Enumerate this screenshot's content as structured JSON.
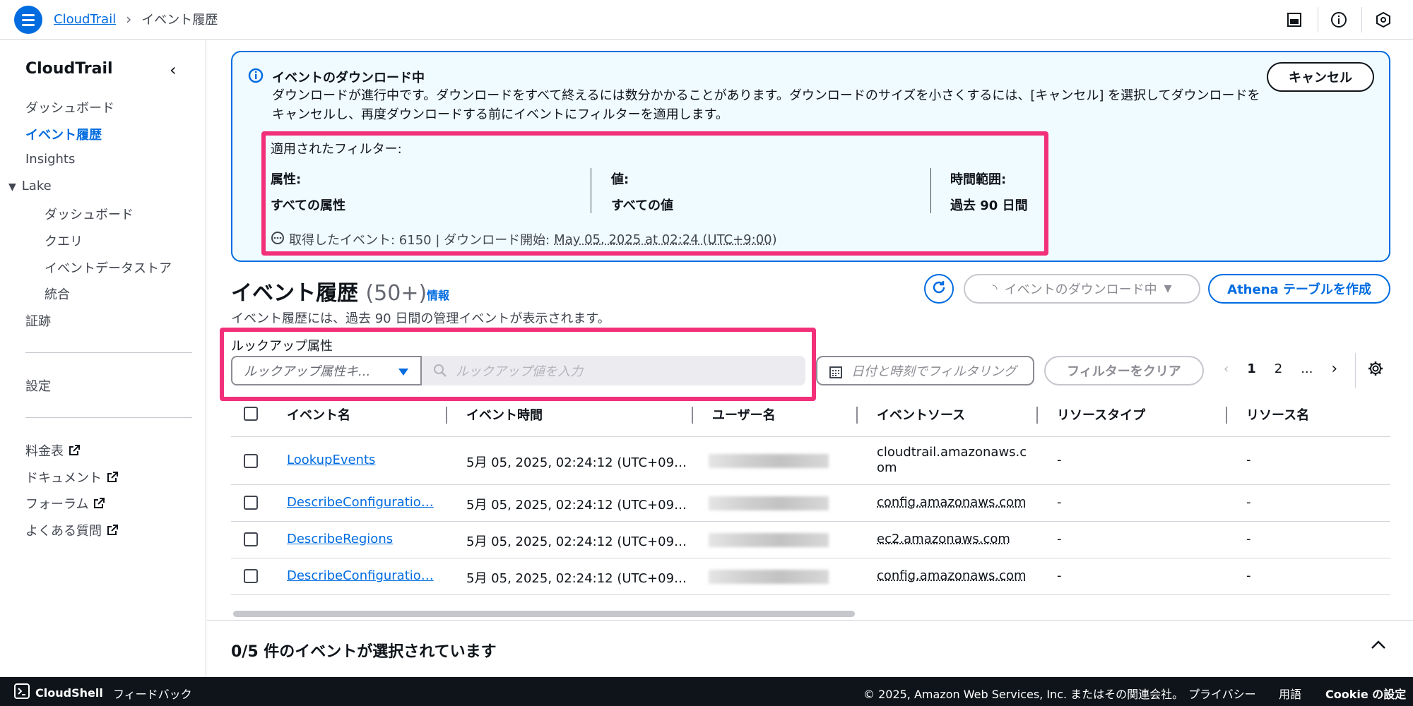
{
  "topbar": {
    "breadcrumb_root": "CloudTrail",
    "breadcrumb_current": "イベント履歴"
  },
  "sidebar": {
    "title": "CloudTrail",
    "items": [
      {
        "label": "ダッシュボード"
      },
      {
        "label": "イベント履歴"
      },
      {
        "label": "Insights"
      },
      {
        "label": "Lake"
      },
      {
        "label": "ダッシュボード"
      },
      {
        "label": "クエリ"
      },
      {
        "label": "イベントデータストア"
      },
      {
        "label": "統合"
      },
      {
        "label": "証跡"
      },
      {
        "label": "設定"
      },
      {
        "label": "料金表"
      },
      {
        "label": "ドキュメント"
      },
      {
        "label": "フォーラム"
      },
      {
        "label": "よくある質問"
      }
    ]
  },
  "banner": {
    "title": "イベントのダウンロード中",
    "description": "ダウンロードが進行中です。ダウンロードをすべて終えるには数分かかることがあります。ダウンロードのサイズを小さくするには、[キャンセル] を選択してダウンロードをキャンセルし、再度ダウンロードする前にイベントにフィルターを適用します。",
    "cancel_label": "キャンセル",
    "applied_filters_label": "適用されたフィルター:",
    "filters": [
      {
        "header": "属性:",
        "value": "すべての属性"
      },
      {
        "header": "値:",
        "value": "すべての値"
      },
      {
        "header": "時間範囲:",
        "value": "過去 90 日間"
      }
    ],
    "fetched_text": "取得したイベント: 6150 | ダウンロード開始:",
    "download_start": "May 05, 2025 at 02:24 (UTC+9:00)"
  },
  "history": {
    "title": "イベント履歴",
    "count": "(50+)",
    "info_label": "情報",
    "description": "イベント履歴には、過去 90 日間の管理イベントが表示されます。",
    "downloading_label": "イベントのダウンロード中",
    "athena_label": "Athena テーブルを作成"
  },
  "lookup": {
    "label": "ルックアップ属性",
    "select_placeholder": "ルックアップ属性キ...",
    "input_placeholder": "ルックアップ値を入力",
    "date_filter_label": "日付と時刻でフィルタリング",
    "clear_label": "フィルターをクリア"
  },
  "pagination": {
    "pages": [
      "1",
      "2",
      "..."
    ]
  },
  "table": {
    "headers": [
      "イベント名",
      "イベント時間",
      "ユーザー名",
      "イベントソース",
      "リソースタイプ",
      "リソース名"
    ],
    "rows": [
      {
        "event": "LookupEvents",
        "time": "5月 05, 2025, 02:24:12 (UTC+09…",
        "source_line1": "cloudtrail.amazonaws.c",
        "source_line2": "om",
        "type": "-",
        "name": "-"
      },
      {
        "event": "DescribeConfiguratio…",
        "time": "5月 05, 2025, 02:24:12 (UTC+09…",
        "source_line1": "config.amazonaws.com",
        "type": "-",
        "name": "-"
      },
      {
        "event": "DescribeRegions",
        "time": "5月 05, 2025, 02:24:12 (UTC+09…",
        "source_line1": "ec2.amazonaws.com",
        "type": "-",
        "name": "-"
      },
      {
        "event": "DescribeConfiguratio…",
        "time": "5月 05, 2025, 02:24:12 (UTC+09…",
        "source_line1": "config.amazonaws.com",
        "type": "-",
        "name": "-"
      }
    ]
  },
  "selection": {
    "text": "0/5 件のイベントが選択されています"
  },
  "footer": {
    "cloudshell": "CloudShell",
    "feedback": "フィードバック",
    "copyright": "© 2025, Amazon Web Services, Inc. またはその関連会社。",
    "privacy": "プライバシー",
    "terms": "用語",
    "cookie": "Cookie の設定"
  },
  "colors": {
    "accent": "#006ce0",
    "highlight": "#f2307a",
    "banner_bg": "#f0fbff",
    "footer_bg": "#0f141a"
  }
}
